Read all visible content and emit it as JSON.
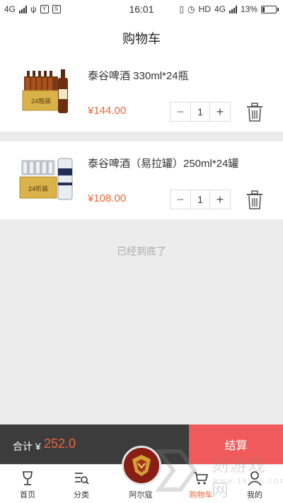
{
  "status_bar": {
    "network_left": "4G",
    "time": "16:01",
    "network_right": "HD",
    "network_right_gen": "4G",
    "battery": "13%"
  },
  "header": {
    "title": "购物车"
  },
  "cart": {
    "items": [
      {
        "name": "泰谷啤酒 330ml*24瓶",
        "price": "¥144.00",
        "quantity": "1",
        "image_label": "24瓶装"
      },
      {
        "name": "泰谷啤酒（易拉罐）250ml*24罐",
        "price": "¥108.00",
        "quantity": "1",
        "image_label": "24听装"
      }
    ],
    "end_note": "已经到底了"
  },
  "checkout": {
    "total_label": "合计 ¥",
    "total_value": "252.0",
    "button_label": "结算"
  },
  "tab_bar": {
    "tabs": [
      {
        "label": "首页",
        "icon": "wine-glass-icon"
      },
      {
        "label": "分类",
        "icon": "category-list-icon"
      },
      {
        "label": "阿尔寇",
        "icon": "brand-logo"
      },
      {
        "label": "购物车",
        "icon": "cart-icon"
      },
      {
        "label": "我的",
        "icon": "user-icon"
      }
    ],
    "active_tab": "购物车"
  },
  "watermark": {
    "text": "刻游戏网",
    "url_text": "www.1kyou.com"
  },
  "colors": {
    "accent": "#e8663d",
    "checkout": "#f05a5a",
    "dark_bar": "#3c3c3c"
  }
}
